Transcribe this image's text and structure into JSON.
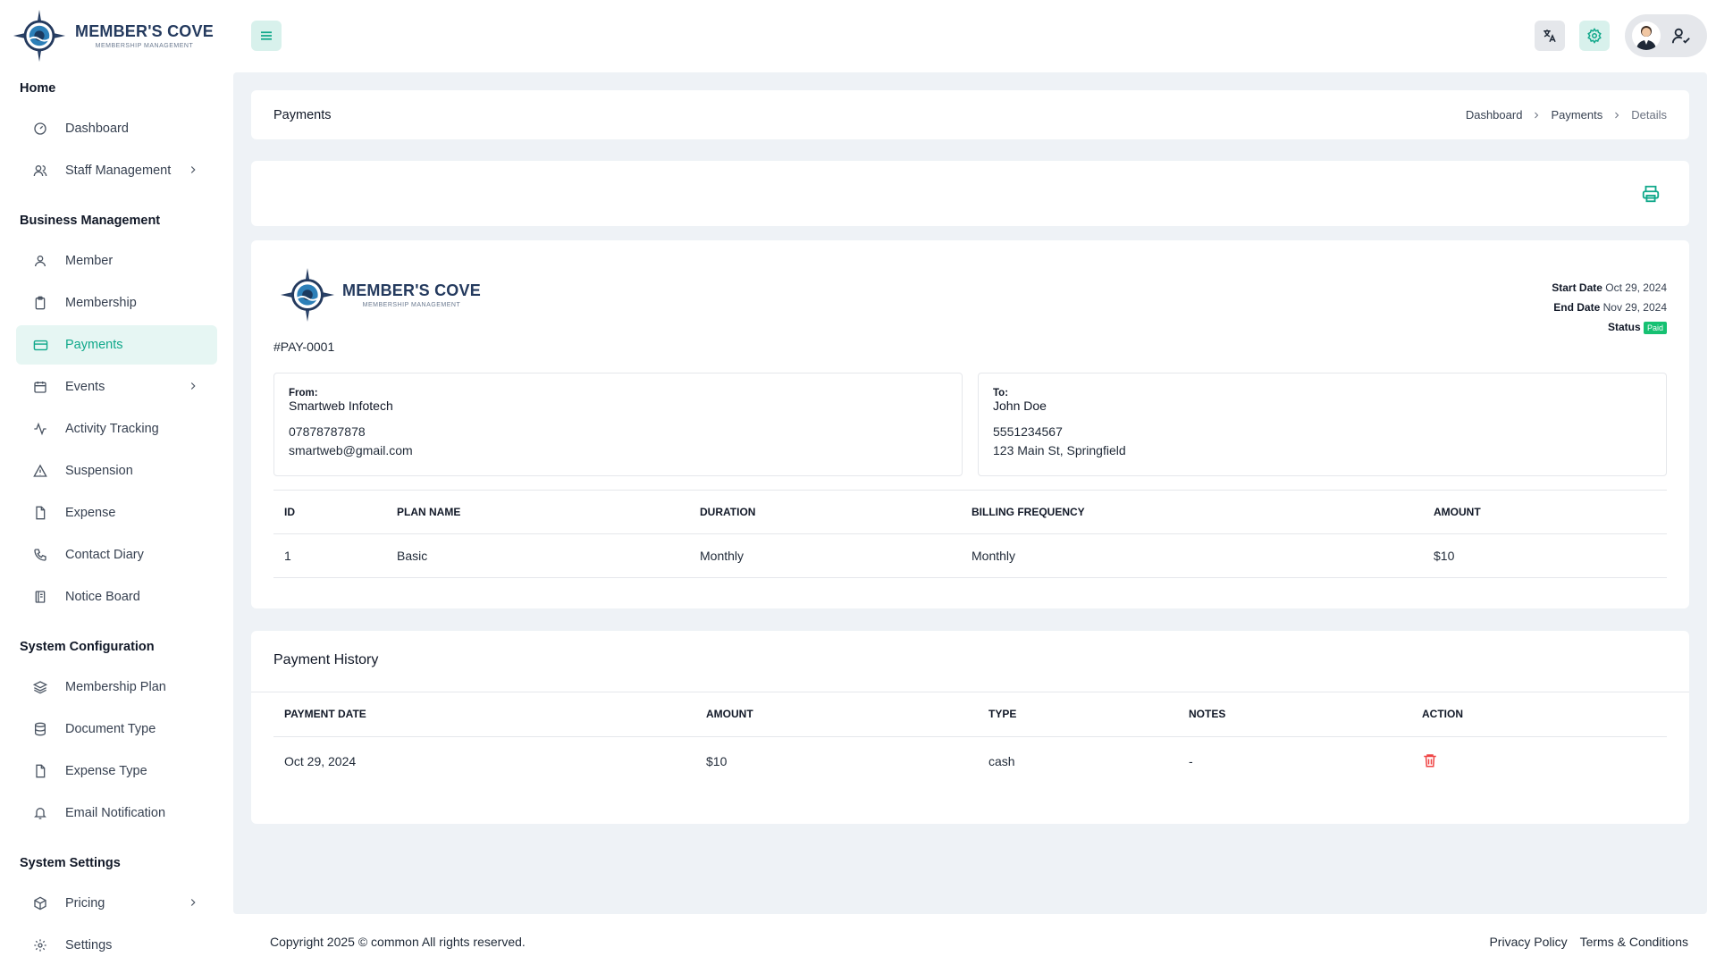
{
  "brand": {
    "name": "MEMBER'S COVE",
    "tagline": "MEMBERSHIP MANAGEMENT"
  },
  "sidebar": {
    "sections": [
      {
        "title": "Home",
        "items": [
          {
            "label": "Dashboard",
            "icon": "gauge-icon"
          },
          {
            "label": "Staff Management",
            "icon": "users-icon",
            "has_children": true
          }
        ]
      },
      {
        "title": "Business Management",
        "items": [
          {
            "label": "Member",
            "icon": "user-icon"
          },
          {
            "label": "Membership",
            "icon": "clipboard-icon"
          },
          {
            "label": "Payments",
            "icon": "credit-card-icon",
            "active": true
          },
          {
            "label": "Events",
            "icon": "calendar-icon",
            "has_children": true
          },
          {
            "label": "Activity Tracking",
            "icon": "activity-icon"
          },
          {
            "label": "Suspension",
            "icon": "warning-icon"
          },
          {
            "label": "Expense",
            "icon": "file-icon"
          },
          {
            "label": "Contact Diary",
            "icon": "phone-icon"
          },
          {
            "label": "Notice Board",
            "icon": "notebook-icon"
          }
        ]
      },
      {
        "title": "System Configuration",
        "items": [
          {
            "label": "Membership Plan",
            "icon": "layers-icon"
          },
          {
            "label": "Document Type",
            "icon": "database-icon"
          },
          {
            "label": "Expense Type",
            "icon": "file-icon"
          },
          {
            "label": "Email Notification",
            "icon": "bell-icon"
          }
        ]
      },
      {
        "title": "System Settings",
        "items": [
          {
            "label": "Pricing",
            "icon": "package-icon",
            "has_children": true
          },
          {
            "label": "Settings",
            "icon": "gear-icon"
          }
        ]
      }
    ]
  },
  "header": {
    "title": "Payments",
    "breadcrumb": [
      "Dashboard",
      "Payments",
      "Details"
    ]
  },
  "invoice": {
    "id": "#PAY-0001",
    "start_date_label": "Start Date",
    "start_date": "Oct 29, 2024",
    "end_date_label": "End Date",
    "end_date": "Nov 29, 2024",
    "status_label": "Status",
    "status": "Paid",
    "from": {
      "label": "From:",
      "name": "Smartweb Infotech",
      "phone": "07878787878",
      "email": "smartweb@gmail.com"
    },
    "to": {
      "label": "To:",
      "name": "John Doe",
      "phone": "5551234567",
      "address": "123 Main St, Springfield"
    },
    "columns": [
      "ID",
      "PLAN NAME",
      "DURATION",
      "BILLING FREQUENCY",
      "AMOUNT"
    ],
    "rows": [
      [
        "1",
        "Basic",
        "Monthly",
        "Monthly",
        "$10"
      ]
    ]
  },
  "history": {
    "title": "Payment History",
    "columns": [
      "PAYMENT DATE",
      "AMOUNT",
      "TYPE",
      "NOTES",
      "ACTION"
    ],
    "rows": [
      {
        "date": "Oct 29, 2024",
        "amount": "$10",
        "type": "cash",
        "notes": "-"
      }
    ]
  },
  "footer": {
    "copyright": "Copyright 2025 © common All rights reserved.",
    "links": [
      "Privacy Policy",
      "Terms & Conditions"
    ]
  },
  "colors": {
    "accent": "#10a88a",
    "accent_bg": "#e6f6f3",
    "status_paid": "#16c172",
    "danger": "#ef4444",
    "brand_navy": "#243a5e"
  }
}
